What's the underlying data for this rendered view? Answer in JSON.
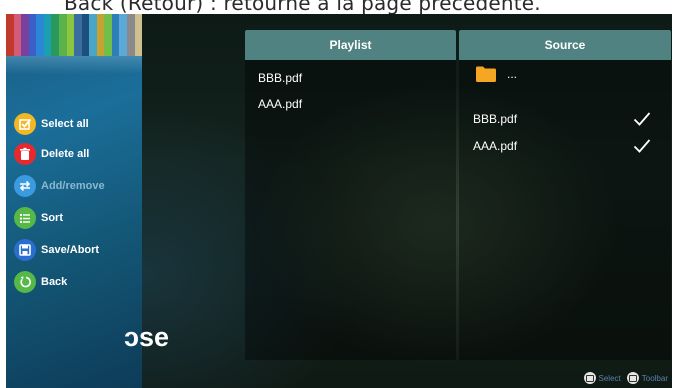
{
  "caption": "Back (Retour) : retourne à la page précédente.",
  "menu": {
    "items": [
      {
        "label": "Select all",
        "icon": "checkbox-edit-icon",
        "color": "#f2b722",
        "enabled": true
      },
      {
        "label": "Delete all",
        "icon": "trash-icon",
        "color": "#e8292c",
        "enabled": true
      },
      {
        "label": "Add/remove",
        "icon": "swap-arrows-icon",
        "color": "#3b9be0",
        "enabled": false
      },
      {
        "label": "Sort",
        "icon": "list-icon",
        "color": "#55b847",
        "enabled": true
      },
      {
        "label": "Save/Abort",
        "icon": "save-icon",
        "color": "#2a6fd0",
        "enabled": true
      },
      {
        "label": "Back",
        "icon": "back-arrow-icon",
        "color": "#55b847",
        "enabled": true
      }
    ]
  },
  "background_text": "ɔse",
  "playlist": {
    "header": "Playlist",
    "files": [
      "BBB.pdf",
      "AAA.pdf"
    ]
  },
  "source": {
    "header": "Source",
    "parent_label": "...",
    "files": [
      {
        "name": "BBB.pdf",
        "checked": true
      },
      {
        "name": "AAA.pdf",
        "checked": true
      }
    ]
  },
  "footer": {
    "select_label": "Select",
    "toolbar_label": "Toolbar"
  },
  "colors": {
    "header_teal": "#4f8280",
    "sidebar_blue": "#1b6e9a",
    "folder_orange": "#f5a623"
  }
}
